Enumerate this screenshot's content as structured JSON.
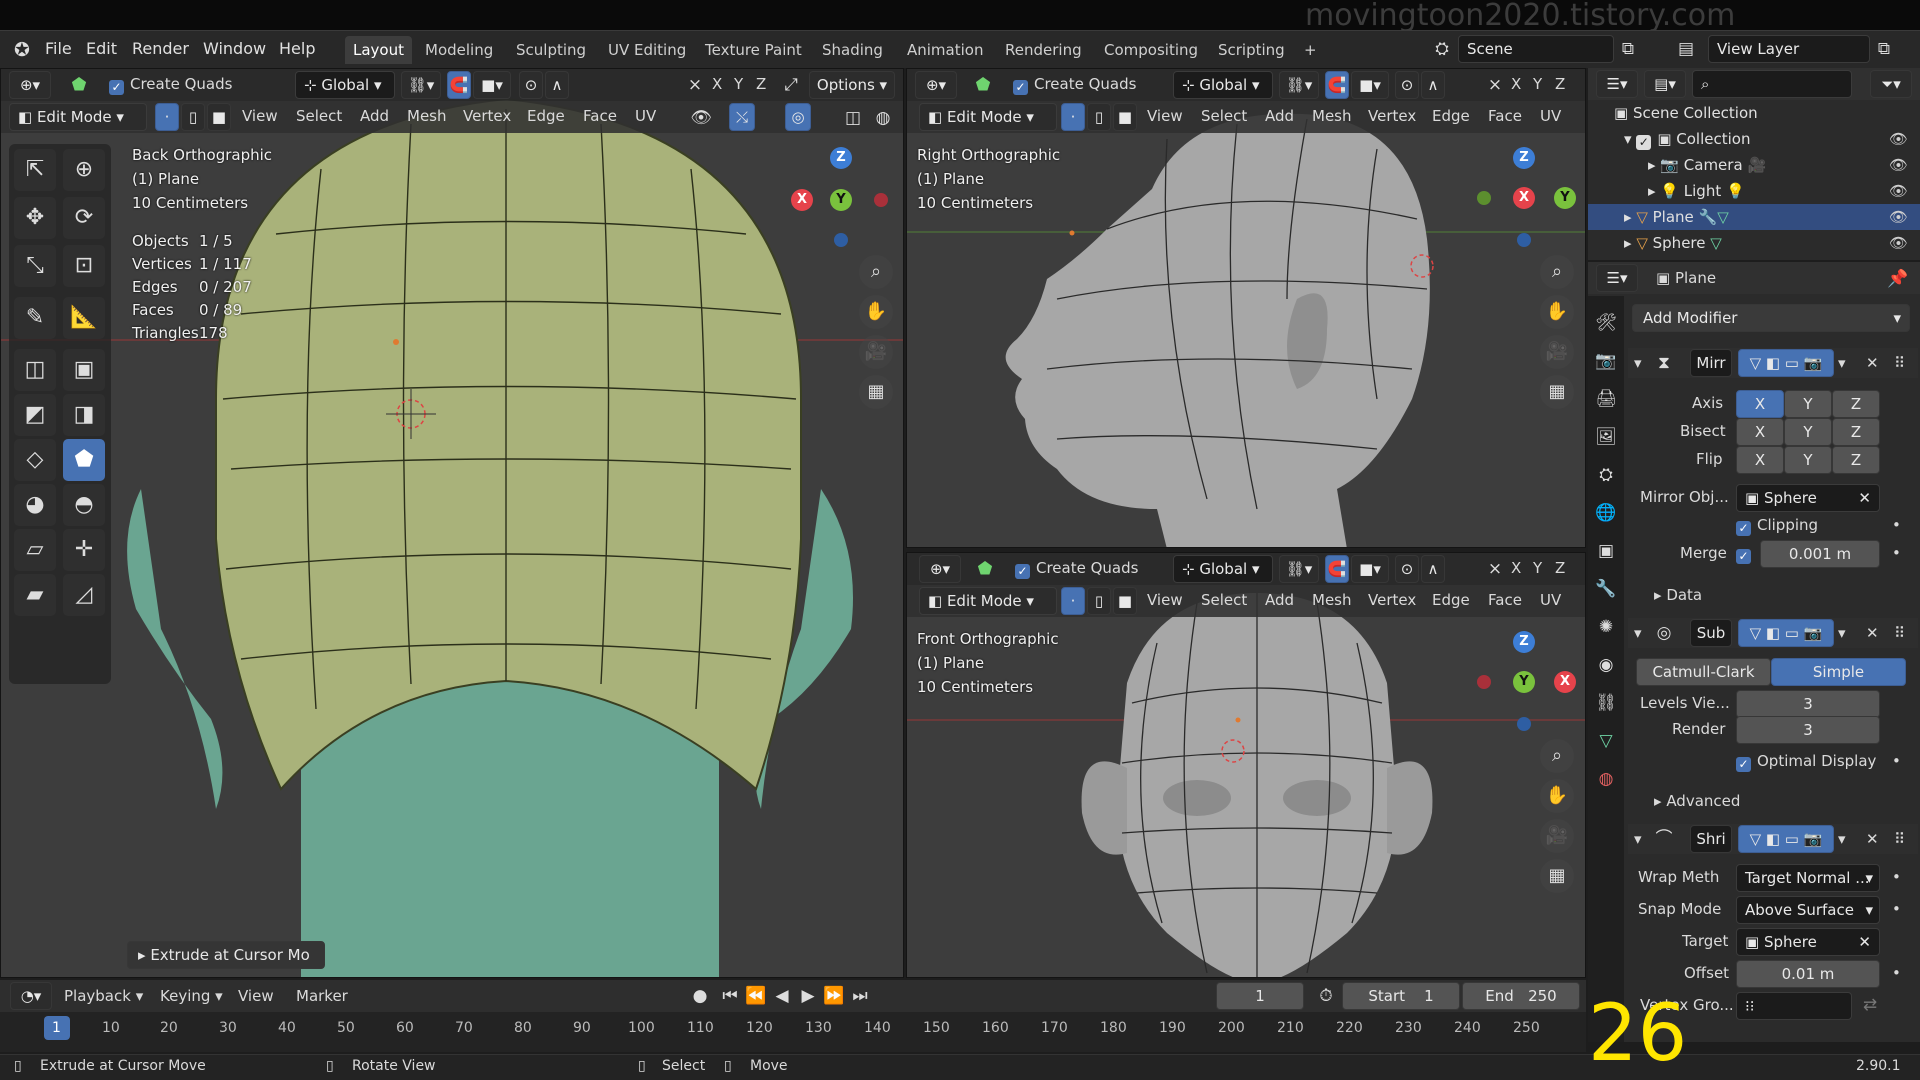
{
  "watermark": "movingtoon2020.tistory.com",
  "menu": {
    "items": [
      "File",
      "Edit",
      "Render",
      "Window",
      "Help"
    ]
  },
  "workspaces": [
    "Layout",
    "Modeling",
    "Sculpting",
    "UV Editing",
    "Texture Paint",
    "Shading",
    "Animation",
    "Rendering",
    "Compositing",
    "Scripting"
  ],
  "workspace_active": "Layout",
  "workspace_add": "+",
  "scene": "Scene",
  "view_layer": "View Layer",
  "toolbar": {
    "create_quads": "Create Quads",
    "orientation": "Global",
    "axis_x": "X",
    "axis_y": "Y",
    "axis_z": "Z",
    "options": "Options",
    "mode": "Edit Mode",
    "header_menus": [
      "View",
      "Select",
      "Add",
      "Mesh",
      "Vertex",
      "Edge",
      "Face",
      "UV"
    ]
  },
  "viewport_back": {
    "title": "Back Orthographic",
    "object": "(1) Plane",
    "scale": "10 Centimeters",
    "stats": [
      {
        "label": "Objects",
        "value": "1 / 5"
      },
      {
        "label": "Vertices",
        "value": "1 / 117"
      },
      {
        "label": "Edges",
        "value": "0 / 207"
      },
      {
        "label": "Faces",
        "value": "0 / 89"
      },
      {
        "label": "Triangles",
        "value": "178"
      }
    ],
    "last_op": "Extrude at Cursor Mo"
  },
  "viewport_right": {
    "title": "Right Orthographic",
    "object": "(1) Plane",
    "scale": "10 Centimeters"
  },
  "viewport_front": {
    "title": "Front Orthographic",
    "object": "(1) Plane",
    "scale": "10 Centimeters"
  },
  "gizmo": {
    "x": "X",
    "y": "Y",
    "z": "Z"
  },
  "outliner": {
    "root": "Scene Collection",
    "collection": "Collection",
    "items": [
      "Camera",
      "Light",
      "Plane",
      "Sphere"
    ],
    "selected": "Plane"
  },
  "properties": {
    "object": "Plane",
    "add_modifier": "Add Modifier",
    "mirror": {
      "name": "Mirr",
      "axis_label": "Axis",
      "bisect_label": "Bisect",
      "flip_label": "Flip",
      "axes": [
        "X",
        "Y",
        "Z"
      ],
      "axis_active": "X",
      "mirror_obj_label": "Mirror Obj...",
      "mirror_obj": "Sphere",
      "clipping": "Clipping",
      "merge_label": "Merge",
      "merge_value": "0.001 m",
      "data": "Data"
    },
    "subsurf": {
      "name": "Sub",
      "catmull": "Catmull-Clark",
      "simple": "Simple",
      "levels_label": "Levels Vie...",
      "levels_value": "3",
      "render_label": "Render",
      "render_value": "3",
      "optimal": "Optimal Display",
      "advanced": "Advanced"
    },
    "shrinkwrap": {
      "name": "Shri",
      "wrap_label": "Wrap Meth",
      "wrap_value": "Target Normal ...",
      "snap_label": "Snap Mode",
      "snap_value": "Above Surface",
      "target_label": "Target",
      "target_value": "Sphere",
      "offset_label": "Offset",
      "offset_value": "0.01 m",
      "vgroup_label": "Vertex Gro..."
    }
  },
  "timeline": {
    "menus": [
      "Playback",
      "Keying",
      "View",
      "Marker"
    ],
    "current_frame": "1",
    "start_label": "Start",
    "start": "1",
    "end_label": "End",
    "end": "250",
    "ticks": [
      "1",
      "10",
      "20",
      "30",
      "40",
      "50",
      "60",
      "70",
      "80",
      "90",
      "100",
      "110",
      "120",
      "130",
      "140",
      "150",
      "160",
      "170",
      "180",
      "190",
      "200",
      "210",
      "220",
      "230",
      "240",
      "250"
    ]
  },
  "statusbar": {
    "left": "Extrude at Cursor Move",
    "middle": "Rotate View",
    "select": "Select",
    "move": "Move",
    "version": "2.90.1"
  },
  "overlay_number": "26",
  "colors": {
    "accent": "#4772b3",
    "header": "#282828",
    "viewport_bg": "#3d3d3d",
    "mesh_green": "#a9b27a",
    "ear_teal": "#6aa591",
    "head_grey": "#a7a7a7"
  }
}
